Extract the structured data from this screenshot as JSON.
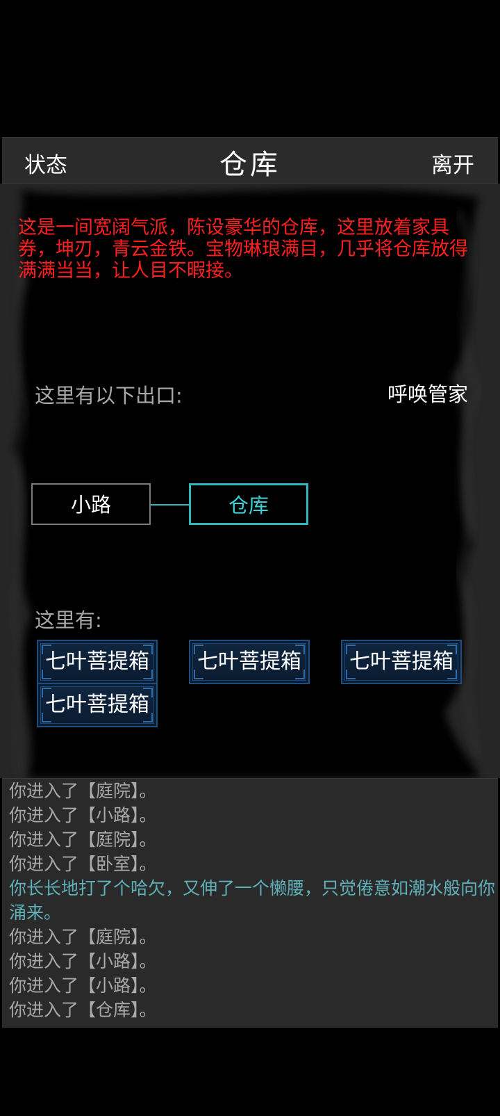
{
  "topbar": {
    "left": "状态",
    "title": "仓库",
    "right": "离开"
  },
  "scene": {
    "description": "这是一间宽阔气派，陈设豪华的仓库，这里放着家具券，坤刃，青云金铁。宝物琳琅满目，几乎将仓库放得满满当当，让人目不暇接。",
    "exits_label": "这里有以下出口:",
    "butler_button": "呼唤管家",
    "rooms": {
      "west": "小路",
      "current": "仓库"
    },
    "here_label": "这里有:",
    "items": [
      "七叶菩提箱",
      "七叶菩提箱",
      "七叶菩提箱",
      "七叶菩提箱"
    ]
  },
  "log": [
    {
      "text": "你进入了【庭院】。",
      "style": "normal"
    },
    {
      "text": "你进入了【小路】。",
      "style": "normal"
    },
    {
      "text": "你进入了【庭院】。",
      "style": "normal"
    },
    {
      "text": "你进入了【卧室】。",
      "style": "normal"
    },
    {
      "text": "你长长地打了个哈欠，又伸了一个懒腰，只觉倦意如潮水般向你涌来。",
      "style": "cyan"
    },
    {
      "text": "你进入了【庭院】。",
      "style": "normal"
    },
    {
      "text": "你进入了【小路】。",
      "style": "normal"
    },
    {
      "text": "你进入了【小路】。",
      "style": "normal"
    },
    {
      "text": "你进入了【仓库】。",
      "style": "normal"
    }
  ],
  "colors": {
    "description": "#ff1f1f",
    "accent": "#2fb8c0",
    "item_border": "#1d4e80",
    "log_highlight": "#5fb0b8"
  }
}
